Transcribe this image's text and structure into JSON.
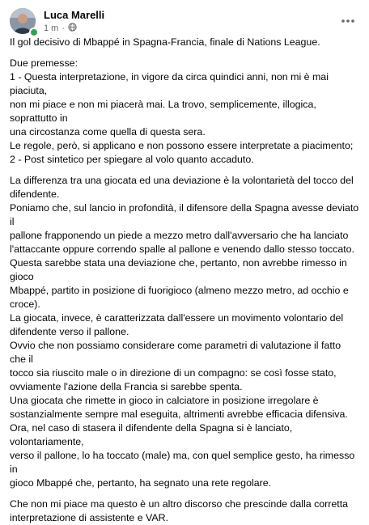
{
  "author": {
    "name": "Luca Marelli"
  },
  "meta": {
    "time": "1 m",
    "separator": "·",
    "audience_icon": "globe-icon",
    "online_color": "#31a24c"
  },
  "more_icon": "more-horizontal-icon",
  "post": {
    "title": "Il gol decisivo di Mbappé in Spagna-Francia, finale di Nations League.",
    "p1": [
      "Due premesse:",
      "1 - Questa interpretazione, in vigore da circa quindici anni, non mi è mai piaciuta,",
      "non mi piace e non mi piacerà mai. La trovo, semplicemente, illogica, soprattutto in",
      "una circostanza come quella di questa sera.",
      "Le regole, però, si applicano e non possono essere interpretate a piacimento;",
      "2 - Post sintetico per spiegare al volo quanto accaduto."
    ],
    "p2": [
      "La differenza tra una giocata ed una deviazione è la volontarietà del tocco del",
      "difendente.",
      "Poniamo che, sul lancio in profondità, il difensore della Spagna avesse deviato il",
      "pallone frapponendo un piede a mezzo metro dall'avversario che ha lanciato",
      "l'attaccante oppure correndo spalle al pallone e venendo dallo stesso toccato.",
      "Questa sarebbe stata una deviazione che, pertanto, non avrebbe rimesso in gioco",
      "Mbappé, partito in posizione di fuorigioco (almeno mezzo metro, ad occhio e",
      "croce).",
      "La giocata, invece, è caratterizzata dall'essere un movimento volontario del",
      "difendente verso il pallone.",
      "Ovvio che non possiamo considerare come parametri di valutazione il fatto che il",
      "tocco sia riuscito male o in direzione di un compagno: se così fosse stato,",
      "ovviamente l'azione della Francia si sarebbe spenta.",
      "Una giocata che rimette in gioco in calciatore in posizione irregolare è",
      "sostanzialmente sempre mal eseguita, altrimenti avrebbe efficacia difensiva.",
      "Ora, nel caso di stasera il difendente della Spagna si è lanciato, volontariamente,",
      "verso il pallone, lo ha toccato (male) ma, con quel semplice gesto, ha rimesso in",
      "gioco Mbappé che, pertanto, ha segnato una rete regolare."
    ],
    "p3": [
      "Che non mi piace ma questo è un altro discorso che prescinde dalla corretta",
      "interpretazione di assistente e VAR."
    ]
  }
}
